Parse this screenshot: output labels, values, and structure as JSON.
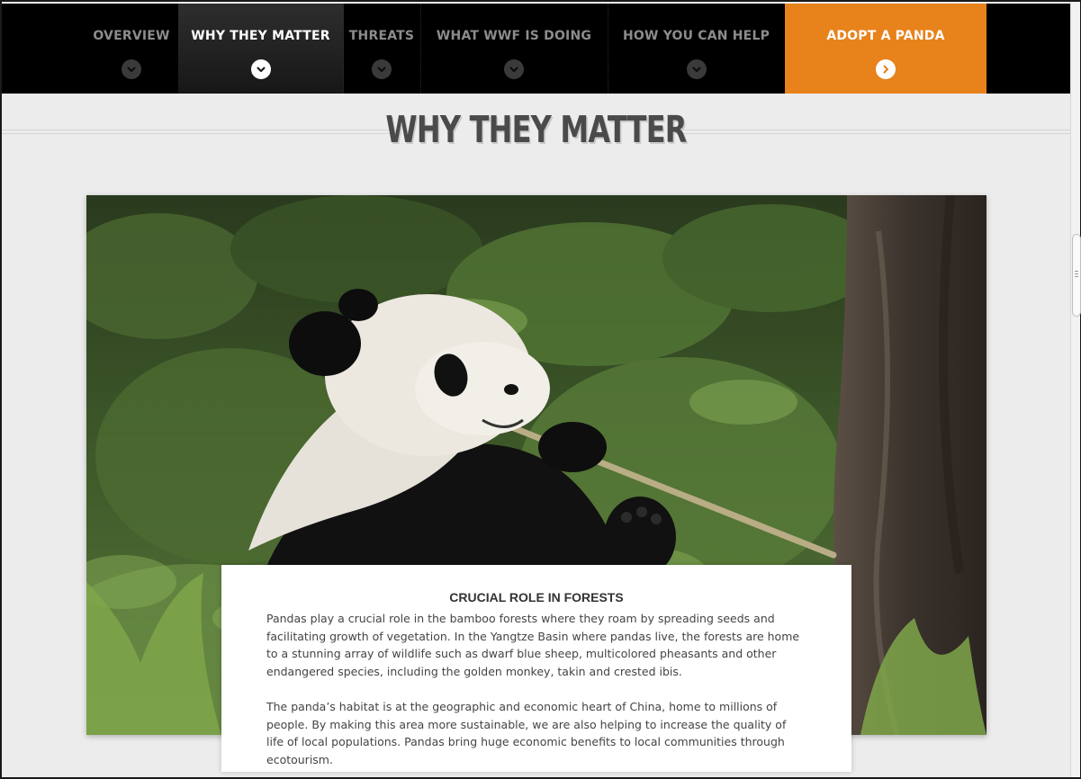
{
  "nav": {
    "items": [
      {
        "label": "OVERVIEW"
      },
      {
        "label": "WHY THEY MATTER"
      },
      {
        "label": "THREATS"
      },
      {
        "label": "WHAT WWF IS DOING"
      },
      {
        "label": "HOW YOU CAN HELP"
      },
      {
        "label": "ADOPT A PANDA"
      }
    ],
    "active_index": 1
  },
  "heading": "WHY THEY MATTER",
  "hero": {
    "icon": "panda-eating-bamboo-photo"
  },
  "card": {
    "title": "CRUCIAL ROLE IN FORESTS",
    "paragraphs": [
      "Pandas play a crucial role in the bamboo forests where they roam by spreading seeds and facilitating growth of vegetation. In the Yangtze Basin where pandas live, the forests are home to a stunning array of wildlife such as dwarf blue sheep, multicolored pheasants and other endangered species, including the golden monkey, takin and crested ibis.",
      "The panda’s habitat is at the geographic and economic heart of China, home to millions of people. By making this area more sustainable, we are also helping to increase the quality of life of local populations. Pandas bring huge economic benefits to local communities through ecotourism."
    ]
  },
  "colors": {
    "accent": "#e8821b",
    "nav_bg": "#000000",
    "page_bg": "#ececec"
  }
}
